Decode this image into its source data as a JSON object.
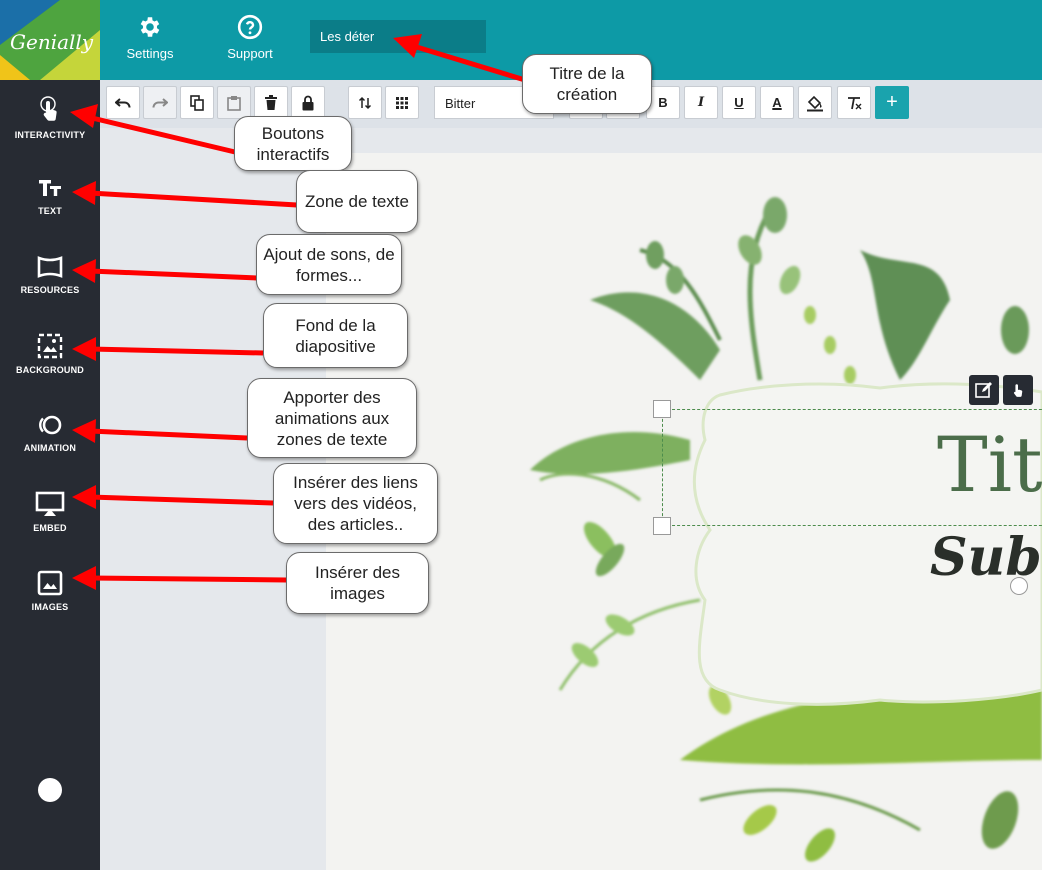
{
  "app": {
    "logo_text": "Genially"
  },
  "topbar": {
    "settings_label": "Settings",
    "support_label": "Support",
    "title_value": "Les déter"
  },
  "sidebar": {
    "items": [
      {
        "label": "INTERACTIVITY",
        "icon": "pointer-hand-icon"
      },
      {
        "label": "TEXT",
        "icon": "text-icon"
      },
      {
        "label": "RESOURCES",
        "icon": "shapes-icon"
      },
      {
        "label": "BACKGROUND",
        "icon": "background-image-icon"
      },
      {
        "label": "ANIMATION",
        "icon": "animation-icon"
      },
      {
        "label": "EMBED",
        "icon": "embed-icon"
      },
      {
        "label": "IMAGES",
        "icon": "image-icon"
      }
    ]
  },
  "toolbar": {
    "font": "Bitter",
    "bold": "B",
    "italic": "I",
    "underline": "U",
    "font_color": "A",
    "add": "+"
  },
  "slide": {
    "title": "Titl",
    "subtitle": "Subt"
  },
  "callouts": {
    "title": "Titre de la création",
    "interactivity": "Boutons interactifs",
    "text": "Zone de texte",
    "resources": "Ajout de sons, de formes...",
    "background": "Fond de la diapositive",
    "animation": "Apporter des animations aux zones de texte",
    "embed": "Insérer des liens vers des vidéos, des articles..",
    "images": "Insérer des images"
  },
  "colors": {
    "topbar": "#0d9aa6",
    "sidebar": "#272b33",
    "accent": "#1aa3ad",
    "arrow": "#ff0000",
    "title_text": "#4b6d4a"
  }
}
